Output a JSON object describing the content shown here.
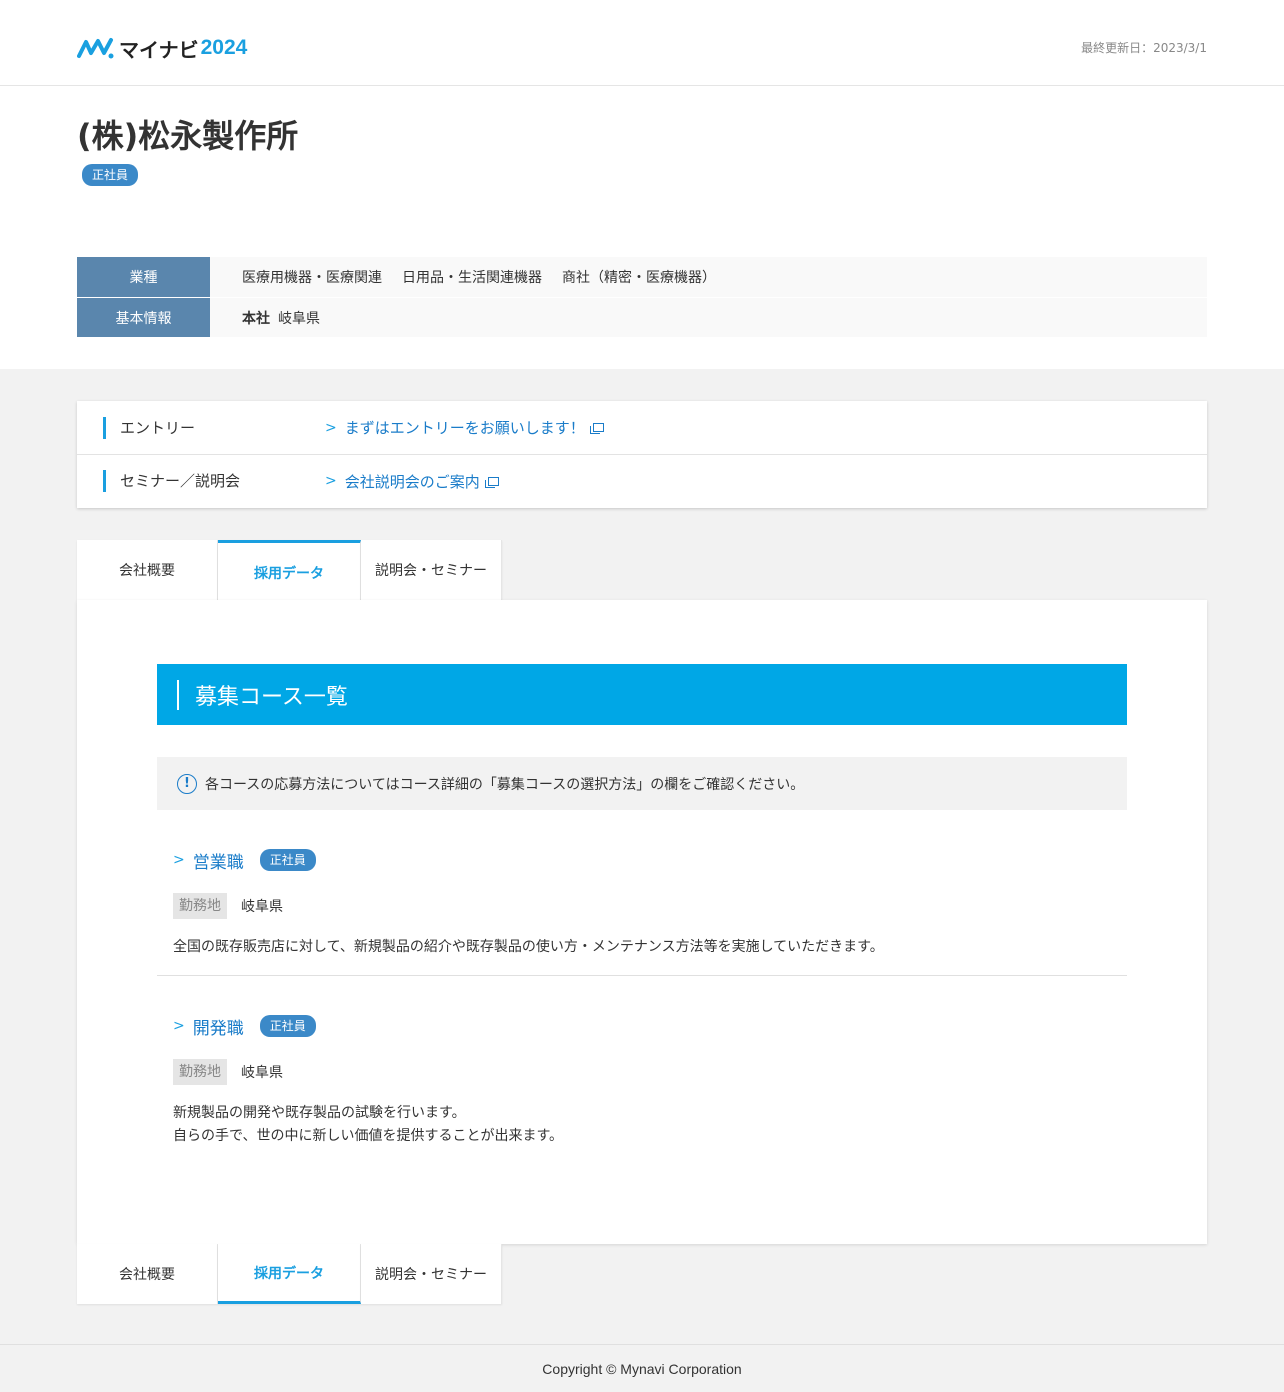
{
  "header": {
    "logo_brand": "マイナビ",
    "logo_year": "2024",
    "updated": "最終更新日：2023/3/1"
  },
  "company": {
    "name": "(株)松永製作所",
    "badge": "正社員"
  },
  "info": {
    "industry_label": "業種",
    "industries": [
      "医療用機器・医療関連",
      "日用品・生活関連機器",
      "商社（精密・医療機器）"
    ],
    "basic_label": "基本情報",
    "hq_label": "本社",
    "hq_value": "岐阜県"
  },
  "entry": {
    "rows": [
      {
        "label": "エントリー",
        "link": "まずはエントリーをお願いします！"
      },
      {
        "label": "セミナー／説明会",
        "link": "会社説明会のご案内"
      }
    ]
  },
  "tabs": [
    {
      "label": "会社概要"
    },
    {
      "label": "採用データ"
    },
    {
      "label": "説明会・セミナー"
    }
  ],
  "section": {
    "title": "募集コース一覧",
    "notice": "各コースの応募方法についてはコース詳細の「募集コースの選択方法」の欄をご確認ください。"
  },
  "courses": [
    {
      "name": "営業職",
      "badge": "正社員",
      "loc_label": "勤務地",
      "loc_value": "岐阜県",
      "desc": [
        "全国の既存販売店に対して、新規製品の紹介や既存製品の使い方・メンテナンス方法等を実施していただきます。"
      ]
    },
    {
      "name": "開発職",
      "badge": "正社員",
      "loc_label": "勤務地",
      "loc_value": "岐阜県",
      "desc": [
        "新規製品の開発や既存製品の試験を行います。",
        "自らの手で、世の中に新しい価値を提供することが出来ます。"
      ]
    }
  ],
  "footer": {
    "copyright": "Copyright © Mynavi Corporation"
  },
  "colors": {
    "accent": "#00a7e6",
    "link": "#1a7cc9",
    "table_header": "#5a86ad",
    "badge": "#3b89c8"
  }
}
